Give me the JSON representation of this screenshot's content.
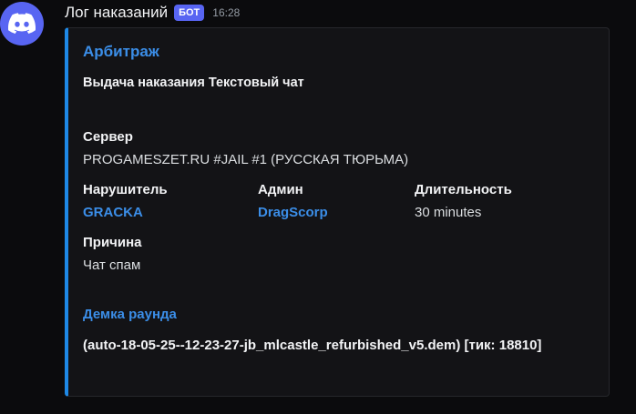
{
  "message": {
    "username": "Лог наказаний",
    "bot_tag": "БОТ",
    "timestamp": "16:28",
    "avatar_icon": "discord-logo-icon"
  },
  "embed": {
    "accent_color": "#1e88e5",
    "author": "Арбитраж",
    "title": "Выдача наказания Текстовый чат",
    "fields": {
      "server": {
        "name": "Сервер",
        "value": "PROGAMESZET.RU #JAIL #1 (РУССКАЯ ТЮРЬМА)"
      },
      "offender": {
        "name": "Нарушитель",
        "value": "GRACKA"
      },
      "admin": {
        "name": "Админ",
        "value": "DragScorp"
      },
      "duration": {
        "name": "Длительность",
        "value": "30 minutes"
      },
      "reason": {
        "name": "Причина",
        "value": "Чат спам"
      }
    },
    "demo": {
      "label": "Демка раунда",
      "file": "(auto-18-05-25--12-23-27-jb_mlcastle_refurbished_v5.dem) [тик: 18810]"
    }
  }
}
